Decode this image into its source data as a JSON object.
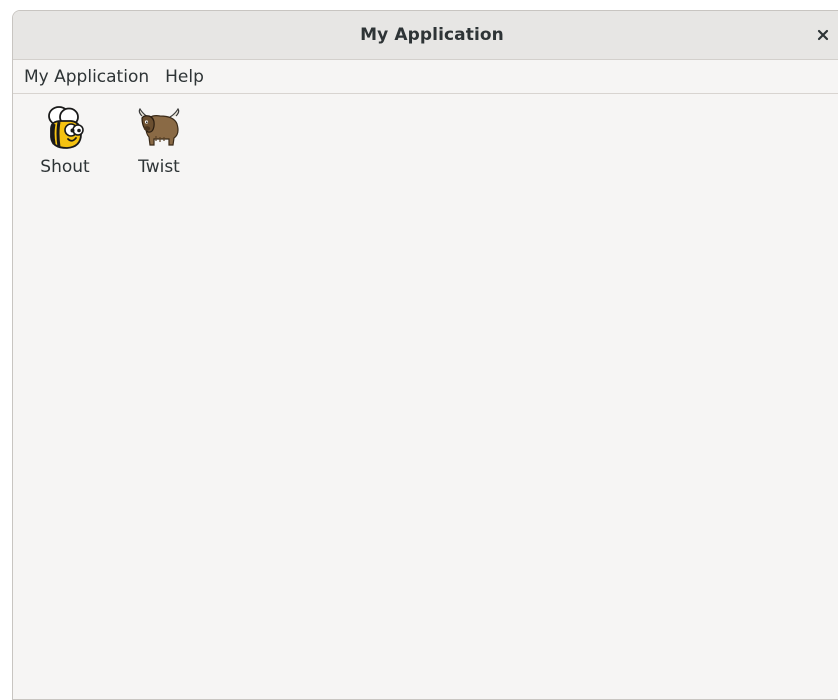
{
  "window": {
    "title": "My Application",
    "close_label": "×"
  },
  "menubar": {
    "items": [
      {
        "label": "My Application"
      },
      {
        "label": "Help"
      }
    ]
  },
  "launcher": {
    "items": [
      {
        "label": "Shout",
        "icon": "bee-icon"
      },
      {
        "label": "Twist",
        "icon": "yak-icon"
      }
    ]
  }
}
